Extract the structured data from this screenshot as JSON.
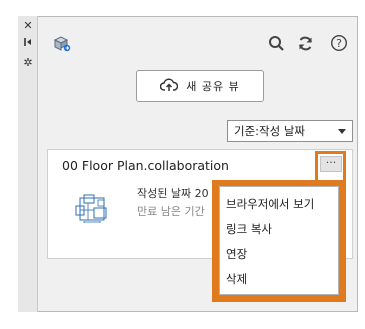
{
  "toolbar": {
    "share_button_label": "새 공유 뷰",
    "sort_select_value": "기준:작성 날짜"
  },
  "collaboration_card": {
    "title": "00 Floor Plan.collaboration",
    "created_label": "작성된 날짜 20",
    "expires_label": "만료 남은 기간",
    "more_label": "···"
  },
  "context_menu": {
    "items": [
      {
        "label": "브라우저에서 보기"
      },
      {
        "label": "링크 복사"
      },
      {
        "label": "연장"
      },
      {
        "label": "삭제"
      }
    ]
  },
  "icons": [
    "close-icon",
    "auto-hide-icon",
    "settings-icon",
    "shared-views-icon",
    "search-icon",
    "refresh-icon",
    "help-icon",
    "cloud-upload-icon",
    "chevron-down-icon",
    "floor-plan-thumbnail"
  ],
  "colors": {
    "highlight": "#e07a1f",
    "panel_bg": "#f0f0f0"
  }
}
